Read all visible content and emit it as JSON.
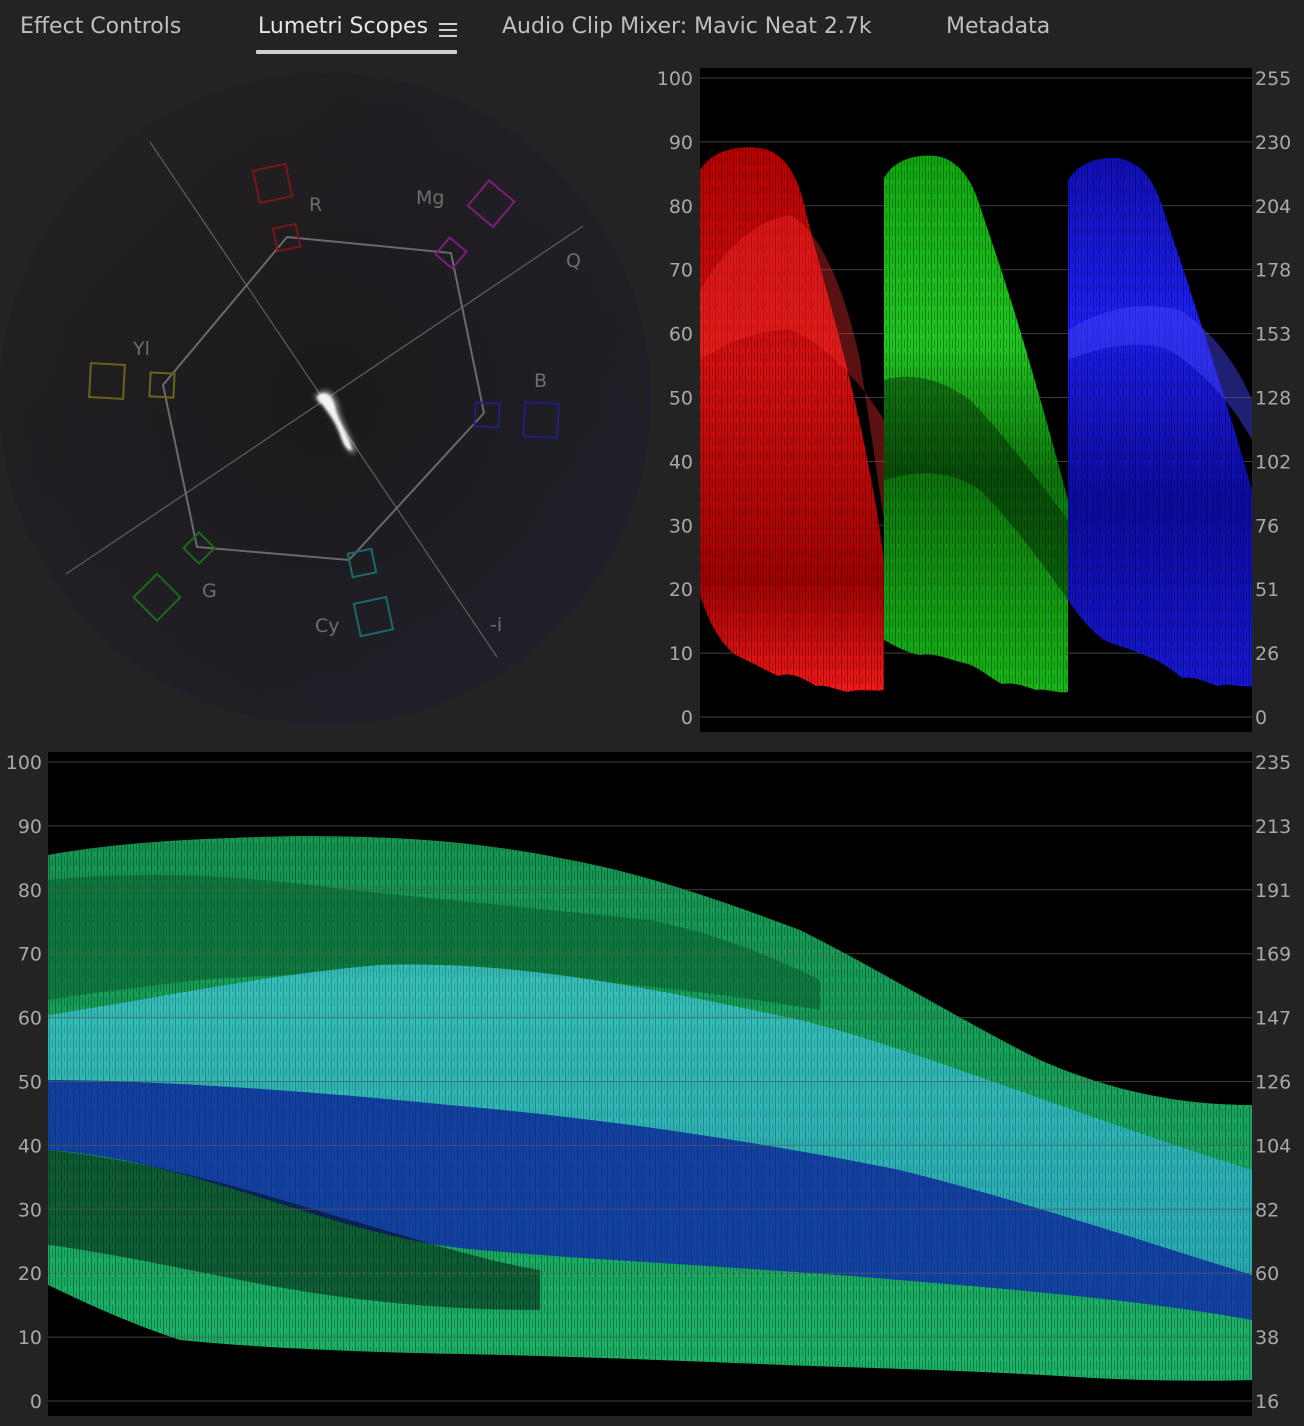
{
  "tabs": [
    {
      "label": "Effect Controls",
      "active": false
    },
    {
      "label": "Lumetri Scopes",
      "active": true
    },
    {
      "label": "Audio Clip Mixer: Mavic Neat 2.7k",
      "active": false
    },
    {
      "label": "Metadata",
      "active": false
    }
  ],
  "vectorscope": {
    "labels": {
      "r": "R",
      "mg": "Mg",
      "q": "Q",
      "yl": "Yl",
      "b": "B",
      "g": "G",
      "cy": "Cy",
      "neg_i": "-i"
    }
  },
  "rgb_parade": {
    "left_ticks": [
      "100",
      "90",
      "80",
      "70",
      "60",
      "50",
      "40",
      "30",
      "20",
      "10",
      "0"
    ],
    "right_ticks": [
      "255",
      "230",
      "204",
      "178",
      "153",
      "128",
      "102",
      "76",
      "51",
      "26",
      "0"
    ]
  },
  "luma_waveform": {
    "left_ticks": [
      "100",
      "90",
      "80",
      "70",
      "60",
      "50",
      "40",
      "30",
      "20",
      "10",
      "0"
    ],
    "right_ticks": [
      "235",
      "213",
      "191",
      "169",
      "147",
      "126",
      "104",
      "82",
      "60",
      "38",
      "16"
    ]
  },
  "colors": {
    "panel_bg": "#232323",
    "scope_bg": "#000000",
    "red": "#e00000",
    "green": "#00d000",
    "blue": "#1818ff",
    "luma_green": "#1fd27a",
    "luma_cyan": "#35b8c8",
    "luma_blue": "#1020b0"
  }
}
